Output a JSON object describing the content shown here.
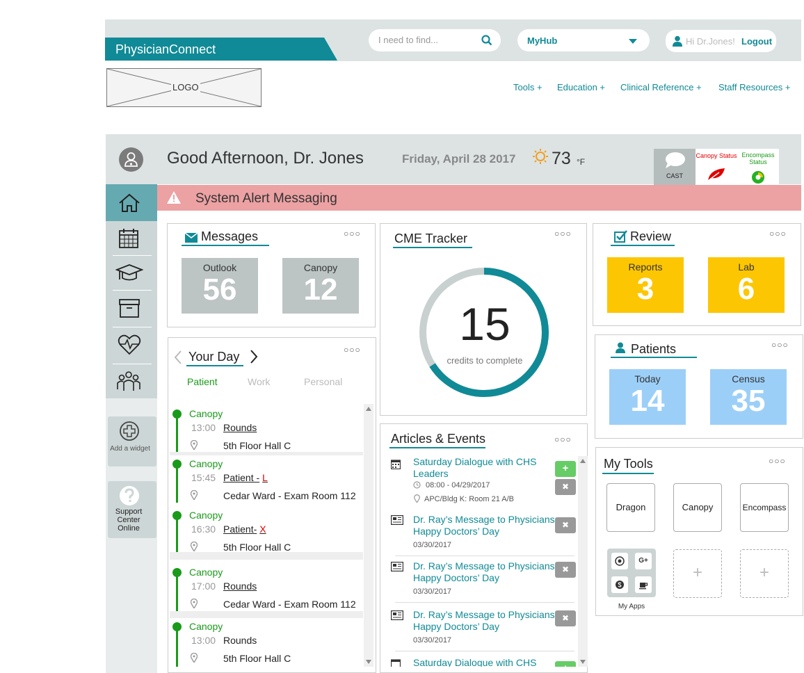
{
  "header": {
    "brand": "PhysicianConnect",
    "search_placeholder": "I need to find...",
    "hub_selected": "MyHub",
    "user_greeting": "Hi Dr.Jones!",
    "logout_label": "Logout",
    "logo_text": "LOGO",
    "accent_color": "#108a96"
  },
  "nav": {
    "items": [
      {
        "label": "Tools +"
      },
      {
        "label": "Education +"
      },
      {
        "label": "Clinical Reference +"
      },
      {
        "label": "Staff Resources +"
      }
    ]
  },
  "greeting": {
    "text": "Good Afternoon, Dr. Jones",
    "date": "Friday, April 28 2017",
    "temperature": "73",
    "unit": "°F"
  },
  "status": {
    "cast_label": "CAST",
    "canopy_label": "Canopy Status",
    "encompass_label": "Encompass Status"
  },
  "alert": {
    "text": "System Alert Messaging",
    "color": "#eca1a3"
  },
  "sidebar": {
    "items": [
      "home-icon",
      "calendar-icon",
      "education-icon",
      "archive-icon",
      "health-icon",
      "group-icon"
    ],
    "add_widget": "Add a widget",
    "support": "Support Center Online"
  },
  "messages": {
    "title": "Messages",
    "tiles": [
      {
        "label": "Outlook",
        "count": "56"
      },
      {
        "label": "Canopy",
        "count": "12"
      }
    ]
  },
  "cme": {
    "title": "CME Tracker",
    "credits": "15",
    "caption": "credits to complete",
    "progress_fraction": 0.66
  },
  "review": {
    "title": "Review",
    "tiles": [
      {
        "label": "Reports",
        "count": "3"
      },
      {
        "label": "Lab",
        "count": "6"
      }
    ]
  },
  "patients": {
    "title": "Patients",
    "tiles": [
      {
        "label": "Today",
        "count": "14"
      },
      {
        "label": "Census",
        "count": "35"
      }
    ]
  },
  "your_day": {
    "title": "Your Day",
    "tabs": [
      "Patient",
      "Work",
      "Personal"
    ],
    "events": [
      {
        "source": "Canopy",
        "time": "13:00",
        "what": "Rounds",
        "mark": "",
        "location": "5th Floor Hall C"
      },
      {
        "source": "Canopy",
        "time": "15:45",
        "what": "Patient -",
        "mark": "L",
        "location": "Cedar Ward - Exam Room 112"
      },
      {
        "source": "Canopy",
        "time": "16:30",
        "what": "Patient-",
        "mark": "X",
        "location": "5th Floor Hall C"
      },
      {
        "source": "Canopy",
        "time": "17:00",
        "what": "Rounds",
        "mark": "",
        "location": "Cedar Ward - Exam Room 112"
      },
      {
        "source": "Canopy",
        "time": "13:00",
        "what": "Rounds",
        "mark": "",
        "location": "5th Floor Hall C"
      }
    ]
  },
  "articles": {
    "title": "Articles & Events",
    "items": [
      {
        "title": "Saturday Dialogue with CHS Leaders",
        "time": "08:00 - 04/29/2017",
        "place": "APC/Bldg K: Room 21 A/B"
      },
      {
        "title": "Dr. Ray’s Message to Physicians: Happy Doctors’ Day",
        "date": "03/30/2017"
      },
      {
        "title": "Dr. Ray’s Message to Physicians: Happy Doctors’ Day",
        "date": "03/30/2017"
      },
      {
        "title": "Dr. Ray’s Message to Physicians: Happy Doctors’ Day",
        "date": "03/30/2017"
      },
      {
        "title": "Saturday Dialogue with CHS"
      }
    ],
    "add_label": "+",
    "remove_label": "✖"
  },
  "tools": {
    "title": "My Tools",
    "items": [
      "Dragon",
      "Canopy",
      "Encompass"
    ],
    "my_apps": "My Apps",
    "add_label": "+"
  },
  "menu_dots": "○○○"
}
